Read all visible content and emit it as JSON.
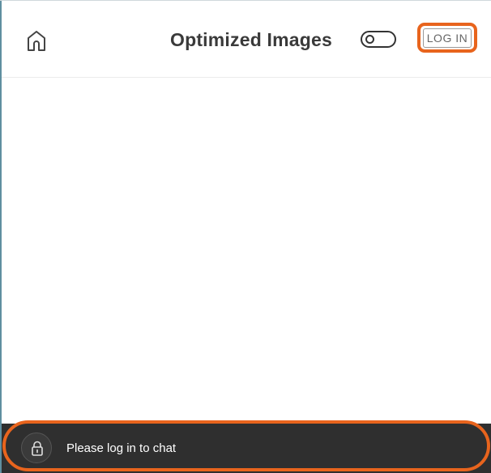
{
  "header": {
    "title": "Optimized Images",
    "home_icon": "home-icon",
    "toggle_icon": "toggle-switch-icon",
    "login_label": "LOG IN"
  },
  "chat": {
    "message": "Please log in to chat",
    "lock_icon": "lock-icon"
  },
  "colors": {
    "highlight": "#e8641d",
    "chat_bar": "#2f2f2f",
    "title_text": "#3a3a3a"
  }
}
